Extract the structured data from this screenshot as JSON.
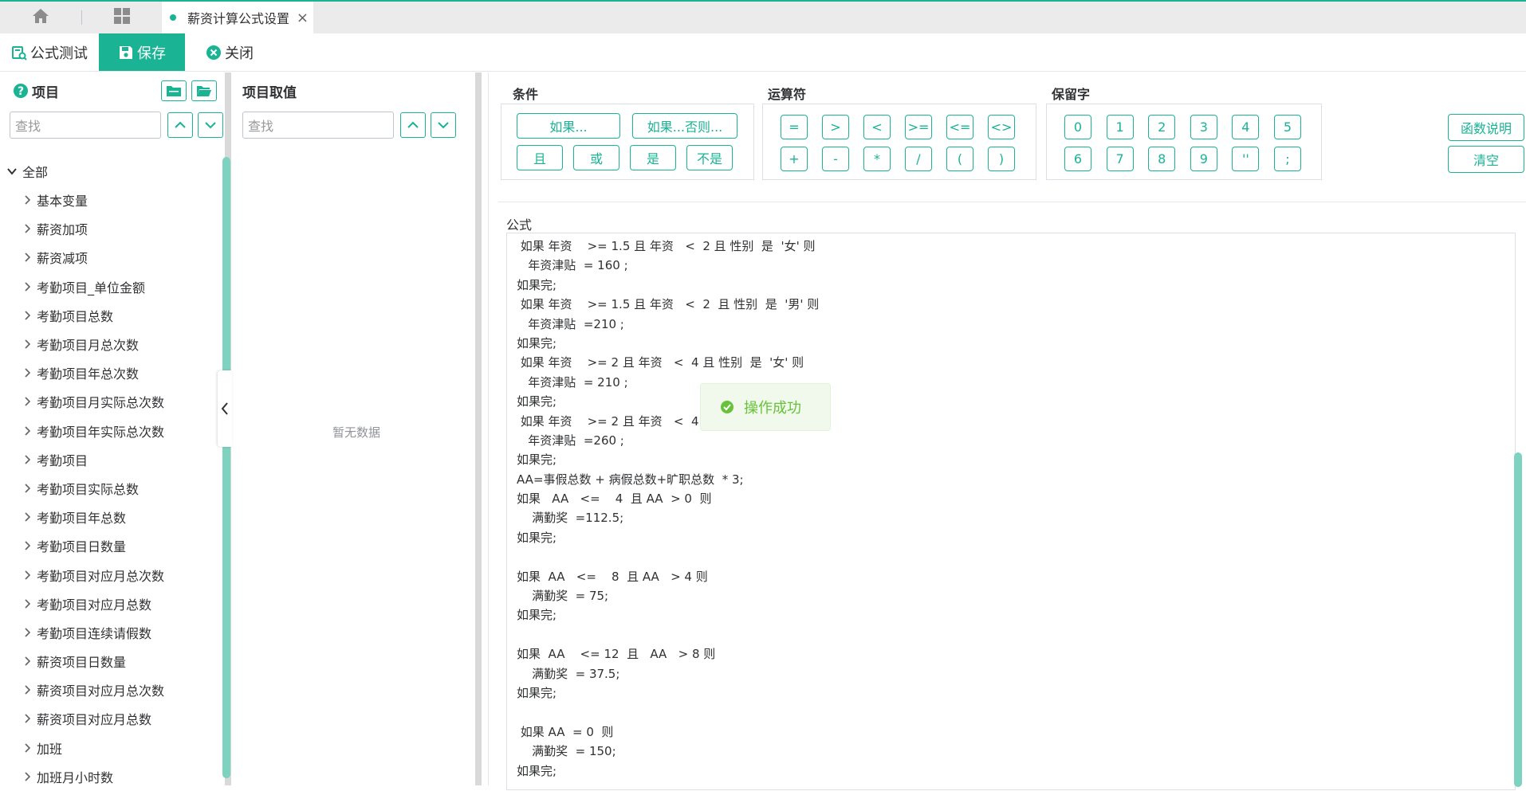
{
  "tabs": {
    "home_icon": "home-icon",
    "grid_icon": "grid-icon",
    "active_tab_label": "薪资计算公式设置",
    "close_glyph": "×"
  },
  "toolbar": {
    "test_label": "公式测试",
    "save_label": "保存",
    "close_label": "关闭"
  },
  "left_panel": {
    "title": "项目",
    "search_placeholder": "查找",
    "root_label": "全部",
    "items": [
      "基本变量",
      "薪资加项",
      "薪资减项",
      "考勤项目_单位金额",
      "考勤项目总数",
      "考勤项目月总次数",
      "考勤项目年总次数",
      "考勤项目月实际总次数",
      "考勤项目年实际总次数",
      "考勤项目",
      "考勤项目实际总数",
      "考勤项目年总数",
      "考勤项目日数量",
      "考勤项目对应月总次数",
      "考勤项目对应月总数",
      "考勤项目连续请假数",
      "薪资项目日数量",
      "薪资项目对应月总次数",
      "薪资项目对应月总数",
      "加班",
      "加班月小时数"
    ]
  },
  "mid_panel": {
    "title": "项目取值",
    "search_placeholder": "查找",
    "empty_text": "暂无数据"
  },
  "conditions": {
    "title": "条件",
    "buttons": [
      "如果...",
      "如果...否则...",
      "且",
      "或",
      "是",
      "不是"
    ]
  },
  "operators": {
    "title": "运算符",
    "buttons": [
      "=",
      ">",
      "<",
      ">=",
      "<=",
      "<>",
      "+",
      "-",
      "*",
      "/",
      "(",
      ")"
    ]
  },
  "reserved": {
    "title": "保留字",
    "buttons": [
      "0",
      "1",
      "2",
      "3",
      "4",
      "5",
      "6",
      "7",
      "8",
      "9",
      "''",
      ";"
    ]
  },
  "side_buttons": {
    "func_help": "函数说明",
    "clear": "清空"
  },
  "formula": {
    "label": "公式",
    "lines": [
      " 如果 年资    >= 1.5 且 年资   <  2 且 性别  是  '女' 则",
      "   年资津贴  = 160 ;",
      "如果完;",
      " 如果 年资    >= 1.5 且 年资   <  2  且 性别  是  '男' 则",
      "   年资津贴  =210 ;",
      "如果完;",
      " 如果 年资    >= 2 且 年资   <  4 且 性别  是  '女' 则",
      "   年资津贴  = 210 ;",
      "如果完;",
      " 如果 年资    >= 2 且 年资   <  4",
      "   年资津贴  =260 ;",
      "如果完;",
      "AA=事假总数 + 病假总数+旷职总数  * 3;",
      "如果   AA   <=    4  且 AA  > 0  则",
      "    满勤奖  =112.5;",
      "如果完;",
      "",
      "如果  AA   <=    8  且 AA   > 4 则",
      "    满勤奖  = 75;",
      "如果完;",
      "",
      "如果  AA    <= 12  且   AA   > 8 则",
      "    满勤奖  = 37.5;",
      "如果完;",
      "",
      " 如果 AA  = 0  则",
      "    满勤奖  = 150;",
      "如果完;"
    ]
  },
  "toast": {
    "message": "操作成功"
  },
  "colors": {
    "accent": "#1ab394",
    "scroll": "#7dd3bf",
    "success": "#67c23a"
  }
}
